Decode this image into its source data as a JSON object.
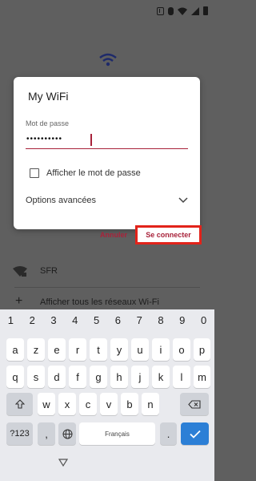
{
  "dialog": {
    "title": "My WiFi",
    "password_label": "Mot de passe",
    "password_value": "••••••••••",
    "show_password_label": "Afficher le mot de passe",
    "show_password_checked": false,
    "advanced_options_label": "Options avancées",
    "cancel_label": "Annuler",
    "connect_label": "Se connecter"
  },
  "wifi_list": {
    "network_sfr": "SFR",
    "show_all": "Afficher tous les réseaux Wi-Fi"
  },
  "keyboard": {
    "numbers": [
      "1",
      "2",
      "3",
      "4",
      "5",
      "6",
      "7",
      "8",
      "9",
      "0"
    ],
    "row1": [
      "a",
      "z",
      "e",
      "r",
      "t",
      "y",
      "u",
      "i",
      "o",
      "p"
    ],
    "row2": [
      "q",
      "s",
      "d",
      "f",
      "g",
      "h",
      "j",
      "k",
      "l",
      "m"
    ],
    "row3": [
      "w",
      "x",
      "c",
      "v",
      "b",
      "n"
    ],
    "symbols_label": "?123",
    "comma": ",",
    "space_label": "Français",
    "period": ".",
    "icons": {
      "shift": "shift-icon",
      "backspace": "backspace-icon",
      "globe": "globe-icon",
      "enter": "checkmark-icon"
    }
  },
  "colors": {
    "accent": "#a8223a",
    "highlight": "#e2231a",
    "enter_key": "#2c7fd6"
  }
}
